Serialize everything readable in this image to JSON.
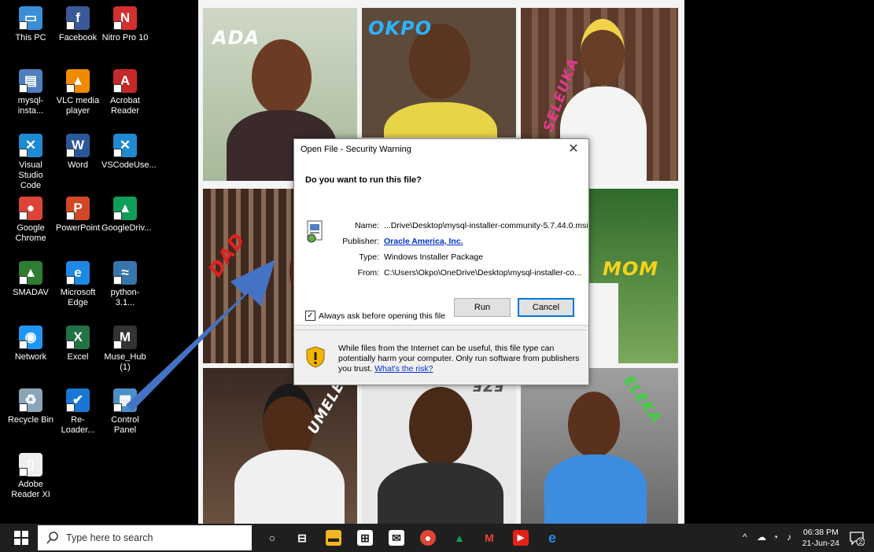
{
  "desktop_icons": [
    {
      "label": "This PC",
      "icon": "this-pc-icon",
      "color": "#3b8fd9",
      "glyph": "▭"
    },
    {
      "label": "Facebook",
      "icon": "facebook-icon",
      "color": "#3b5998",
      "glyph": "f"
    },
    {
      "label": "Nitro Pro 10",
      "icon": "nitro-pro-icon",
      "color": "#d32f2f",
      "glyph": "N"
    },
    {
      "label": "mysql-insta...",
      "icon": "mysql-installer-icon",
      "color": "#4f7fbf",
      "glyph": "▤"
    },
    {
      "label": "VLC media player",
      "icon": "vlc-icon",
      "color": "#f08a00",
      "glyph": "▲"
    },
    {
      "label": "Acrobat Reader",
      "icon": "acrobat-reader-icon",
      "color": "#c62828",
      "glyph": "A"
    },
    {
      "label": "Visual Studio Code",
      "icon": "vscode-icon",
      "color": "#1f8ad2",
      "glyph": "✕"
    },
    {
      "label": "Word",
      "icon": "word-icon",
      "color": "#2b579a",
      "glyph": "W"
    },
    {
      "label": "VSCodeUse...",
      "icon": "vscode-user-icon",
      "color": "#1f8ad2",
      "glyph": "✕"
    },
    {
      "label": "Google Chrome",
      "icon": "chrome-icon",
      "color": "#db4437",
      "glyph": "●"
    },
    {
      "label": "PowerPoint",
      "icon": "powerpoint-icon",
      "color": "#d24726",
      "glyph": "P"
    },
    {
      "label": "GoogleDriv...",
      "icon": "google-drive-icon",
      "color": "#0f9d58",
      "glyph": "▲"
    },
    {
      "label": "SMADAV",
      "icon": "smadav-icon",
      "color": "#2e7d32",
      "glyph": "▲"
    },
    {
      "label": "Microsoft Edge",
      "icon": "edge-icon",
      "color": "#1e88e5",
      "glyph": "e"
    },
    {
      "label": "python-3.1...",
      "icon": "python-icon",
      "color": "#3776ab",
      "glyph": "≈"
    },
    {
      "label": "Network",
      "icon": "network-icon",
      "color": "#2196f3",
      "glyph": "◉"
    },
    {
      "label": "Excel",
      "icon": "excel-icon",
      "color": "#217346",
      "glyph": "X"
    },
    {
      "label": "Muse_Hub (1)",
      "icon": "muse-hub-icon",
      "color": "#333333",
      "glyph": "M"
    },
    {
      "label": "Recycle Bin",
      "icon": "recycle-bin-icon",
      "color": "#8aa4b8",
      "glyph": "♻"
    },
    {
      "label": "Re-Loader...",
      "icon": "reloader-icon",
      "color": "#1976d2",
      "glyph": "✔"
    },
    {
      "label": "Control Panel",
      "icon": "control-panel-icon",
      "color": "#4a90c8",
      "glyph": "▦"
    },
    {
      "label": "Adobe Reader XI",
      "icon": "adobe-reader-icon",
      "color": "#eeeeee",
      "glyph": "▯"
    }
  ],
  "wallpaper_tags": [
    "ADA",
    "OKPO",
    "SELEUKA",
    "DAD",
    "MOM",
    "UMELE",
    "EZE",
    "ELEKA"
  ],
  "dialog": {
    "title": "Open File - Security Warning",
    "question": "Do you want to run this file?",
    "fields": [
      {
        "key": "Name:",
        "value": "...Drive\\Desktop\\mysql-installer-community-5.7.44.0.msi",
        "link": false
      },
      {
        "key": "Publisher:",
        "value": "Oracle America, Inc.",
        "link": true
      },
      {
        "key": "Type:",
        "value": "Windows Installer Package",
        "link": false
      },
      {
        "key": "From:",
        "value": "C:\\Users\\Okpo\\OneDrive\\Desktop\\mysql-installer-co...",
        "link": false
      }
    ],
    "run_label": "Run",
    "cancel_label": "Cancel",
    "checkbox_label": "Always ask before opening this file",
    "checkbox_checked": true,
    "warning_text": "While files from the Internet can be useful, this file type can potentially harm your computer. Only run software from publishers you trust.",
    "warning_link": "What's the risk?"
  },
  "taskbar": {
    "search_placeholder": "Type here to search",
    "clock_time": "06:38 PM",
    "clock_date": "21-Jun-24",
    "notification_count": "2"
  },
  "colors": {
    "accent": "#0078d7",
    "arrow": "#4472c4",
    "taskbar": "#1f1f1f"
  }
}
